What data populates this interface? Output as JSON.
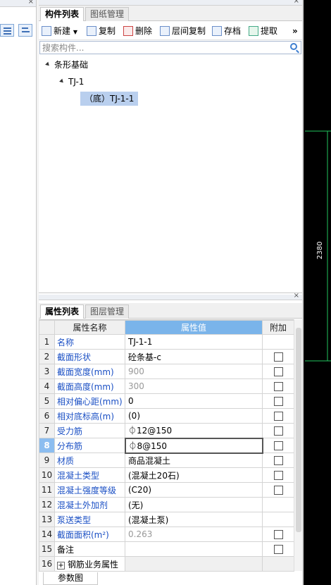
{
  "component_panel": {
    "tabs": [
      {
        "label": "构件列表",
        "active": true
      },
      {
        "label": "图纸管理",
        "active": false
      }
    ],
    "toolbar": [
      {
        "label": "新建",
        "icon": "new-icon",
        "dropdown": true
      },
      {
        "label": "复制",
        "icon": "copy-icon"
      },
      {
        "label": "删除",
        "icon": "delete-icon"
      },
      {
        "label": "层间复制",
        "icon": "floor-copy-icon"
      },
      {
        "label": "存档",
        "icon": "archive-icon"
      },
      {
        "label": "提取",
        "icon": "extract-icon"
      }
    ],
    "more_glyph": "»",
    "search": {
      "placeholder": "搜索构件..."
    },
    "tree": [
      {
        "label": "条形基础",
        "level": 0,
        "expanded": true
      },
      {
        "label": "TJ-1",
        "level": 1,
        "expanded": true
      },
      {
        "label": "（底）TJ-1-1",
        "level": 2,
        "selected": true
      }
    ]
  },
  "property_panel": {
    "tabs": [
      {
        "label": "属性列表",
        "active": true
      },
      {
        "label": "图层管理",
        "active": false
      }
    ],
    "columns": {
      "name": "属性名称",
      "value": "属性值",
      "extra": "附加"
    },
    "rows": [
      {
        "no": "1",
        "name": "名称",
        "value": "TJ-1-1",
        "checkbox": false,
        "link": true
      },
      {
        "no": "2",
        "name": "截面形状",
        "value": "砼条基-c",
        "checkbox": true,
        "link": true
      },
      {
        "no": "3",
        "name": "截面宽度(mm)",
        "value": "900",
        "checkbox": true,
        "link": true,
        "gray": true
      },
      {
        "no": "4",
        "name": "截面高度(mm)",
        "value": "300",
        "checkbox": true,
        "link": true,
        "gray": true
      },
      {
        "no": "5",
        "name": "相对偏心距(mm)",
        "value": "0",
        "checkbox": true,
        "link": true
      },
      {
        "no": "6",
        "name": "相对底标高(m)",
        "value": "(0)",
        "checkbox": true,
        "link": true
      },
      {
        "no": "7",
        "name": "受力筋",
        "value": "⏀12@150",
        "checkbox": true,
        "link": true
      },
      {
        "no": "8",
        "name": "分布筋",
        "value": "⏀8@150",
        "checkbox": true,
        "link": true,
        "active": true
      },
      {
        "no": "9",
        "name": "材质",
        "value": "商品混凝土",
        "checkbox": true,
        "link": true
      },
      {
        "no": "10",
        "name": "混凝土类型",
        "value": "(混凝土20石)",
        "checkbox": true,
        "link": true
      },
      {
        "no": "11",
        "name": "混凝土强度等级",
        "value": "(C20)",
        "checkbox": true,
        "link": true
      },
      {
        "no": "12",
        "name": "混凝土外加剂",
        "value": "(无)",
        "checkbox": false,
        "link": true
      },
      {
        "no": "13",
        "name": "泵送类型",
        "value": "(混凝土泵)",
        "checkbox": false,
        "link": true
      },
      {
        "no": "14",
        "name": "截面面积(m²)",
        "value": "0.263",
        "checkbox": true,
        "link": true,
        "gray": true
      },
      {
        "no": "15",
        "name": "备注",
        "value": "",
        "checkbox": true,
        "link": false
      },
      {
        "no": "16",
        "name": "钢筋业务属性",
        "value": "",
        "checkbox": false,
        "link": false,
        "expand": true,
        "expand_glyph": "+"
      }
    ],
    "bottom_tab": "参数图"
  },
  "drawing": {
    "dimension_label": "2380",
    "line_color": "#22c55e",
    "background": "#000000"
  }
}
